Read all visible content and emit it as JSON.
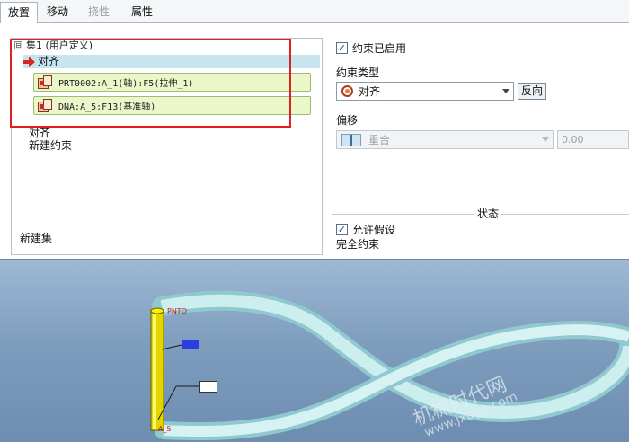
{
  "tabs": [
    {
      "label": "放置",
      "active": true,
      "disabled": false
    },
    {
      "label": "移动",
      "active": false,
      "disabled": false
    },
    {
      "label": "挠性",
      "active": false,
      "disabled": true
    },
    {
      "label": "属性",
      "active": false,
      "disabled": false
    }
  ],
  "tree": {
    "expander": "⊟",
    "set_label": "集1 (用户定义)",
    "selected_constraint": "对齐",
    "refs": [
      "PRT0002:A_1(轴):F5(拉伸_1)",
      "DNA:A_5:F13(基准轴)"
    ],
    "constraint": "对齐",
    "new_constraint": "新建约束",
    "new_set": "新建集"
  },
  "constraint_enabled": {
    "label": "约束已启用",
    "checked": true
  },
  "constraint_type": {
    "label": "约束类型",
    "value": "对齐",
    "flip_button": "反向"
  },
  "offset": {
    "label": "偏移",
    "value": "重合",
    "number": "0.00"
  },
  "status": {
    "heading": "状态",
    "allow_assumptions": "允许假设",
    "allow_checked": true,
    "result": "完全约束"
  },
  "viewport": {
    "axis_label_top": "PNTO",
    "axis_label_bottom": "A_5",
    "callout_1": "A_1",
    "callout_2": "A_5",
    "watermark_1": "机械时代网",
    "watermark_2": "www.jxage.com"
  },
  "colors": {
    "highlight": "#e02020",
    "ref_field": "#ecf7c9",
    "tree_selection": "#c8e4ef",
    "viewport": "#7f9dbd",
    "ribbon": "#c9ecec",
    "axis": "#f0e000"
  },
  "icons": {
    "set_expander": "collapse-icon",
    "selected": "red-arrow-icon",
    "ref": "part-reference-icon",
    "type": "align-ring-icon",
    "offset": "coincident-icon"
  }
}
